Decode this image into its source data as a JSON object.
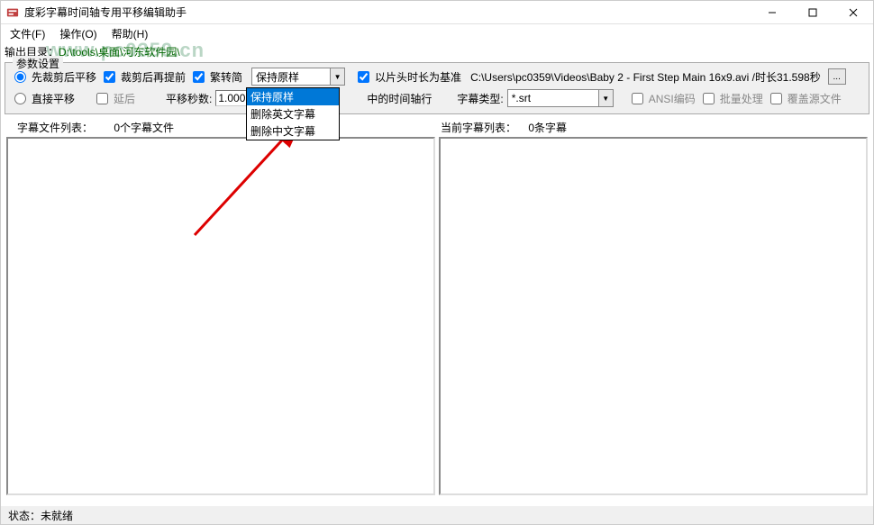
{
  "titlebar": {
    "title": "度彩字幕时间轴专用平移编辑助手"
  },
  "menubar": {
    "file": "文件(F)",
    "operation": "操作(O)",
    "help": "帮助(H)"
  },
  "output": {
    "label": "输出目录：",
    "path": "D:\\tools\\桌面\\河东软件园\\"
  },
  "watermark": "www.pc0359.cn",
  "params": {
    "legend": "参数设置",
    "row1": {
      "radio_trim_first": "先裁剪后平移",
      "check_trim_front": "裁剪后再提前",
      "check_trad_simp": "繁转简",
      "combo_keep": "保持原样",
      "check_use_header": "以片头时长为基准",
      "file_info": "C:\\Users\\pc0359\\Videos\\Baby 2 - First Step Main 16x9.avi  /时长31.598秒"
    },
    "row2": {
      "radio_direct": "直接平移",
      "check_delay": "延后",
      "shift_label": "平移秒数:",
      "shift_value": "1.000",
      "middle_text": "中的时间轴行",
      "subtitle_type_label": "字幕类型:",
      "subtitle_type_value": "*.srt",
      "check_ansi": "ANSI编码",
      "check_batch": "批量处理",
      "check_overwrite": "覆盖源文件"
    },
    "dropdown": {
      "opt1": "保持原样",
      "opt2": "删除英文字幕",
      "opt3": "删除中文字幕"
    }
  },
  "lists": {
    "left_label": "字幕文件列表：",
    "left_count": "0个字幕文件",
    "right_label": "当前字幕列表：",
    "right_count": "0条字幕"
  },
  "status": {
    "label": "状态：",
    "text": "未就绪"
  }
}
